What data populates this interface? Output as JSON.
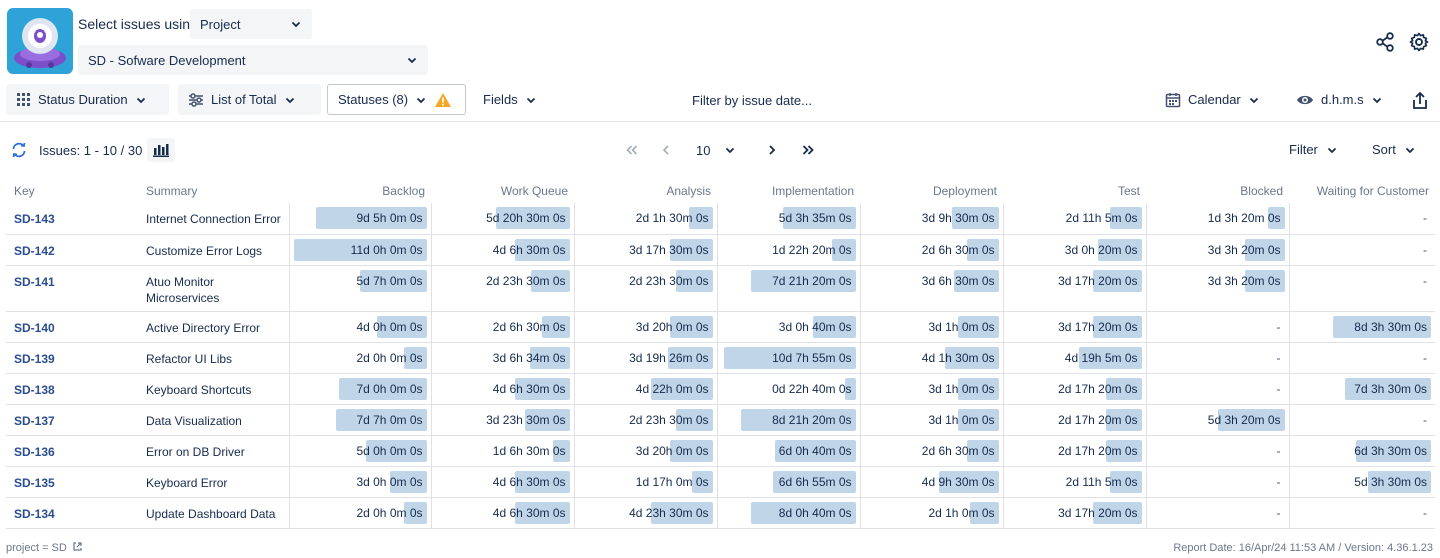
{
  "header": {
    "select_label": "Select issues using",
    "select_mode": "Project",
    "project": "SD - Sofware Development"
  },
  "toolbar": {
    "status_duration": "Status Duration",
    "list_of_total": "List of Total",
    "statuses": "Statuses (8)",
    "fields": "Fields",
    "filter_date": "Filter by issue date...",
    "calendar": "Calendar",
    "format": "d.h.m.s"
  },
  "issues_bar": {
    "count": "Issues: 1 - 10 / 30",
    "page_size": "10",
    "filter": "Filter",
    "sort": "Sort"
  },
  "table": {
    "columns": [
      "Key",
      "Summary",
      "Backlog",
      "Work Queue",
      "Analysis",
      "Implementation",
      "Deployment",
      "Test",
      "Blocked",
      "Waiting for Customer"
    ],
    "rows": [
      {
        "key": "SD-143",
        "summary": "Internet Connection Error",
        "cells": [
          {
            "text": "9d 5h 0m 0s",
            "fill": 0.82
          },
          {
            "text": "5d 20h 30m 0s",
            "fill": 0.54
          },
          {
            "text": "2d 1h 30m 0s",
            "fill": 0.17
          },
          {
            "text": "5d 3h 35m 0s",
            "fill": 0.53
          },
          {
            "text": "3d 9h 30m 0s",
            "fill": 0.34
          },
          {
            "text": "2d 11h 5m 0s",
            "fill": 0.23
          },
          {
            "text": "1d 3h 20m 0s",
            "fill": 0.12
          },
          {
            "text": "-",
            "fill": 0
          }
        ]
      },
      {
        "key": "SD-142",
        "summary": "Customize Error Logs",
        "cells": [
          {
            "text": "11d 0h 0m 0s",
            "fill": 0.98
          },
          {
            "text": "4d 6h 30m 0s",
            "fill": 0.4
          },
          {
            "text": "3d 17h 30m 0s",
            "fill": 0.31
          },
          {
            "text": "1d 22h 20m 0s",
            "fill": 0.17
          },
          {
            "text": "2d 6h 30m 0s",
            "fill": 0.23
          },
          {
            "text": "3d 0h 20m 0s",
            "fill": 0.32
          },
          {
            "text": "3d 3h 20m 0s",
            "fill": 0.29
          },
          {
            "text": "-",
            "fill": 0
          }
        ]
      },
      {
        "key": "SD-141",
        "summary": "Atuo Monitor Microservices",
        "cells": [
          {
            "text": "5d 7h 0m 0s",
            "fill": 0.49
          },
          {
            "text": "2d 23h 30m 0s",
            "fill": 0.28
          },
          {
            "text": "2d 23h 30m 0s",
            "fill": 0.27
          },
          {
            "text": "7d 21h 20m 0s",
            "fill": 0.77
          },
          {
            "text": "3d 6h 30m 0s",
            "fill": 0.33
          },
          {
            "text": "3d 17h 20m 0s",
            "fill": 0.36
          },
          {
            "text": "3d 3h 20m 0s",
            "fill": 0.29
          },
          {
            "text": "-",
            "fill": 0
          }
        ]
      },
      {
        "key": "SD-140",
        "summary": "Active Directory Error",
        "cells": [
          {
            "text": "4d 0h 0m 0s",
            "fill": 0.37
          },
          {
            "text": "2d 6h 30m 0s",
            "fill": 0.2
          },
          {
            "text": "3d 20h 0m 0s",
            "fill": 0.31
          },
          {
            "text": "3d 0h 40m 0s",
            "fill": 0.31
          },
          {
            "text": "3d 1h 0m 0s",
            "fill": 0.3
          },
          {
            "text": "3d 17h 20m 0s",
            "fill": 0.36
          },
          {
            "text": "-",
            "fill": 0
          },
          {
            "text": "8d 3h 30m 0s",
            "fill": 0.7
          }
        ]
      },
      {
        "key": "SD-139",
        "summary": "Refactor UI Libs",
        "cells": [
          {
            "text": "2d 0h 0m 0s",
            "fill": 0.17
          },
          {
            "text": "3d 6h 34m 0s",
            "fill": 0.29
          },
          {
            "text": "3d 19h 26m 0s",
            "fill": 0.33
          },
          {
            "text": "10d 7h 55m 0s",
            "fill": 0.97
          },
          {
            "text": "4d 1h 30m 0s",
            "fill": 0.39
          },
          {
            "text": "4d 19h 5m 0s",
            "fill": 0.46
          },
          {
            "text": "-",
            "fill": 0
          },
          {
            "text": "-",
            "fill": 0
          }
        ]
      },
      {
        "key": "SD-138",
        "summary": "Keyboard Shortcuts",
        "cells": [
          {
            "text": "7d 0h 0m 0s",
            "fill": 0.65
          },
          {
            "text": "4d 6h 30m 0s",
            "fill": 0.4
          },
          {
            "text": "4d 22h 0m 0s",
            "fill": 0.45
          },
          {
            "text": "0d 22h 40m 0s",
            "fill": 0.08
          },
          {
            "text": "3d 1h 0m 0s",
            "fill": 0.3
          },
          {
            "text": "2d 17h 20m 0s",
            "fill": 0.26
          },
          {
            "text": "-",
            "fill": 0
          },
          {
            "text": "7d 3h 30m 0s",
            "fill": 0.62
          }
        ]
      },
      {
        "key": "SD-137",
        "summary": "Data Visualization",
        "cells": [
          {
            "text": "7d 7h 0m 0s",
            "fill": 0.67
          },
          {
            "text": "3d 23h 30m 0s",
            "fill": 0.33
          },
          {
            "text": "2d 23h 30m 0s",
            "fill": 0.27
          },
          {
            "text": "8d 21h 20m 0s",
            "fill": 0.84
          },
          {
            "text": "3d 1h 0m 0s",
            "fill": 0.3
          },
          {
            "text": "2d 17h 20m 0s",
            "fill": 0.26
          },
          {
            "text": "5d 3h 20m 0s",
            "fill": 0.49
          },
          {
            "text": "-",
            "fill": 0
          }
        ]
      },
      {
        "key": "SD-136",
        "summary": "Error on DB Driver",
        "cells": [
          {
            "text": "5d 0h 0m 0s",
            "fill": 0.45
          },
          {
            "text": "1d 6h 30m 0s",
            "fill": 0.12
          },
          {
            "text": "3d 20h 0m 0s",
            "fill": 0.31
          },
          {
            "text": "6d 0h 40m 0s",
            "fill": 0.59
          },
          {
            "text": "2d 6h 30m 0s",
            "fill": 0.23
          },
          {
            "text": "2d 17h 20m 0s",
            "fill": 0.26
          },
          {
            "text": "-",
            "fill": 0
          },
          {
            "text": "6d 3h 30m 0s",
            "fill": 0.54
          }
        ]
      },
      {
        "key": "SD-135",
        "summary": "Keyboard Error",
        "cells": [
          {
            "text": "3d 0h 0m 0s",
            "fill": 0.27
          },
          {
            "text": "4d 6h 30m 0s",
            "fill": 0.4
          },
          {
            "text": "1d 17h 0m 0s",
            "fill": 0.15
          },
          {
            "text": "6d 6h 55m 0s",
            "fill": 0.61
          },
          {
            "text": "4d 9h 30m 0s",
            "fill": 0.44
          },
          {
            "text": "2d 11h 5m 0s",
            "fill": 0.23
          },
          {
            "text": "-",
            "fill": 0
          },
          {
            "text": "5d 3h 30m 0s",
            "fill": 0.45
          }
        ]
      },
      {
        "key": "SD-134",
        "summary": "Update Dashboard Data",
        "cells": [
          {
            "text": "2d 0h 0m 0s",
            "fill": 0.17
          },
          {
            "text": "4d 6h 30m 0s",
            "fill": 0.4
          },
          {
            "text": "4d 23h 30m 0s",
            "fill": 0.45
          },
          {
            "text": "8d 0h 40m 0s",
            "fill": 0.77
          },
          {
            "text": "2d 1h 0m 0s",
            "fill": 0.21
          },
          {
            "text": "3d 17h 20m 0s",
            "fill": 0.36
          },
          {
            "text": "-",
            "fill": 0
          },
          {
            "text": "-",
            "fill": 0
          }
        ]
      }
    ]
  },
  "footer": {
    "query": "project = SD",
    "report": "Report Date: 16/Apr/24 11:53 AM / Version: 4.36.1.23"
  },
  "colors": {
    "bar": "#c0d6e8",
    "key_link": "#2a4d8f",
    "warning": "#f5a623"
  }
}
